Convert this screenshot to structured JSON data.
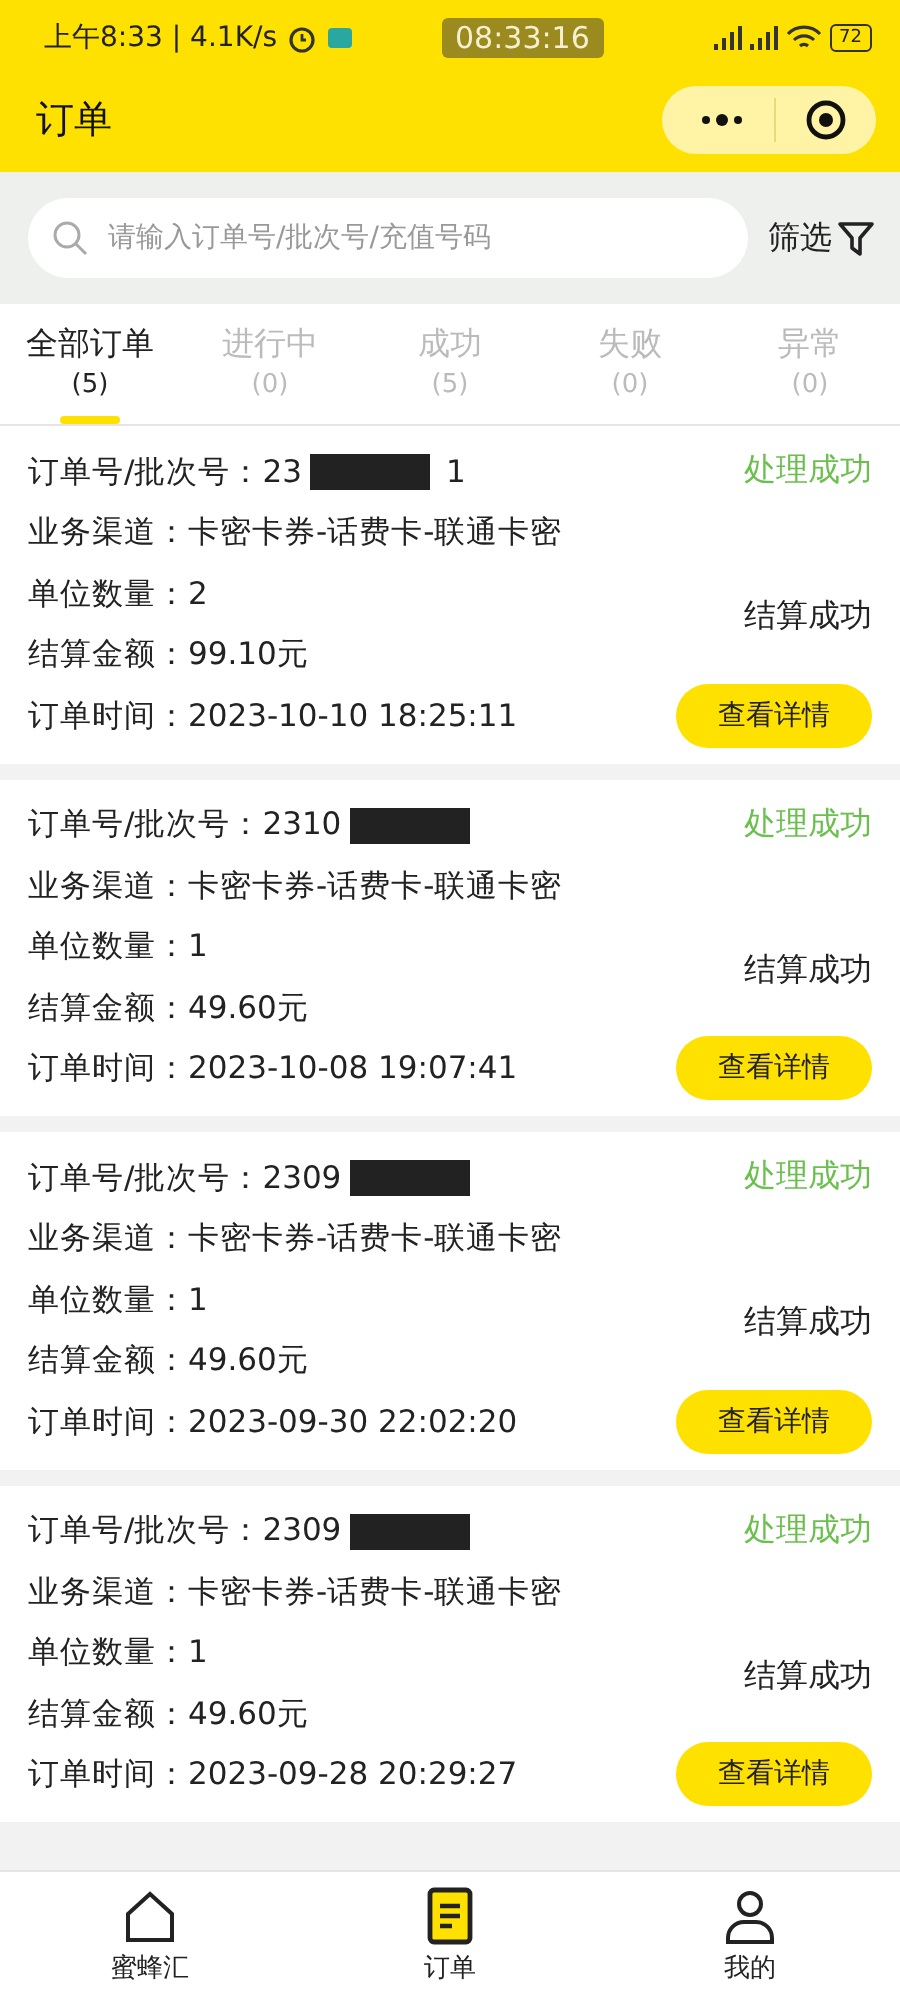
{
  "status_bar": {
    "left": "上午8:33 | 4.1K/s",
    "clock": "08:33:16",
    "battery": "72"
  },
  "header": {
    "title": "订单"
  },
  "search": {
    "placeholder": "请输入订单号/批次号/充值号码",
    "filter": "筛选"
  },
  "tabs": [
    {
      "label": "全部订单",
      "count": "(5)",
      "selected": true
    },
    {
      "label": "进行中",
      "count": "(0)",
      "selected": false
    },
    {
      "label": "成功",
      "count": "(5)",
      "selected": false
    },
    {
      "label": "失败",
      "count": "(0)",
      "selected": false
    },
    {
      "label": "异常",
      "count": "(0)",
      "selected": false
    }
  ],
  "orders": [
    {
      "order_label": "订单号/批次号：",
      "order_no": "23",
      "order_tail": "1",
      "status": "处理成功",
      "channel": "业务渠道：卡密卡券-话费卡-联通卡密",
      "quantity": "单位数量：2",
      "settle": "结算成功",
      "amount": "结算金额：99.10元",
      "time": "订单时间：2023-10-10 18:25:11",
      "button": "查看详情"
    },
    {
      "order_label": "订单号/批次号：",
      "order_no": "2310",
      "status": "处理成功",
      "channel": "业务渠道：卡密卡券-话费卡-联通卡密",
      "quantity": "单位数量：1",
      "settle": "结算成功",
      "amount": "结算金额：49.60元",
      "time": "订单时间：2023-10-08 19:07:41",
      "button": "查看详情"
    },
    {
      "order_label": "订单号/批次号：",
      "order_no": "2309",
      "status": "处理成功",
      "channel": "业务渠道：卡密卡券-话费卡-联通卡密",
      "quantity": "单位数量：1",
      "settle": "结算成功",
      "amount": "结算金额：49.60元",
      "time": "订单时间：2023-09-30 22:02:20",
      "button": "查看详情"
    },
    {
      "order_label": "订单号/批次号：",
      "order_no": "2309",
      "status": "处理成功",
      "channel": "业务渠道：卡密卡券-话费卡-联通卡密",
      "quantity": "单位数量：1",
      "settle": "结算成功",
      "amount": "结算金额：49.60元",
      "time": "订单时间：2023-09-28 20:29:27",
      "button": "查看详情"
    }
  ],
  "nav": [
    {
      "label": "蜜蜂汇",
      "kind": "home",
      "selected": false
    },
    {
      "label": "订单",
      "kind": "orders",
      "selected": true
    },
    {
      "label": "我的",
      "kind": "profile",
      "selected": false
    }
  ]
}
